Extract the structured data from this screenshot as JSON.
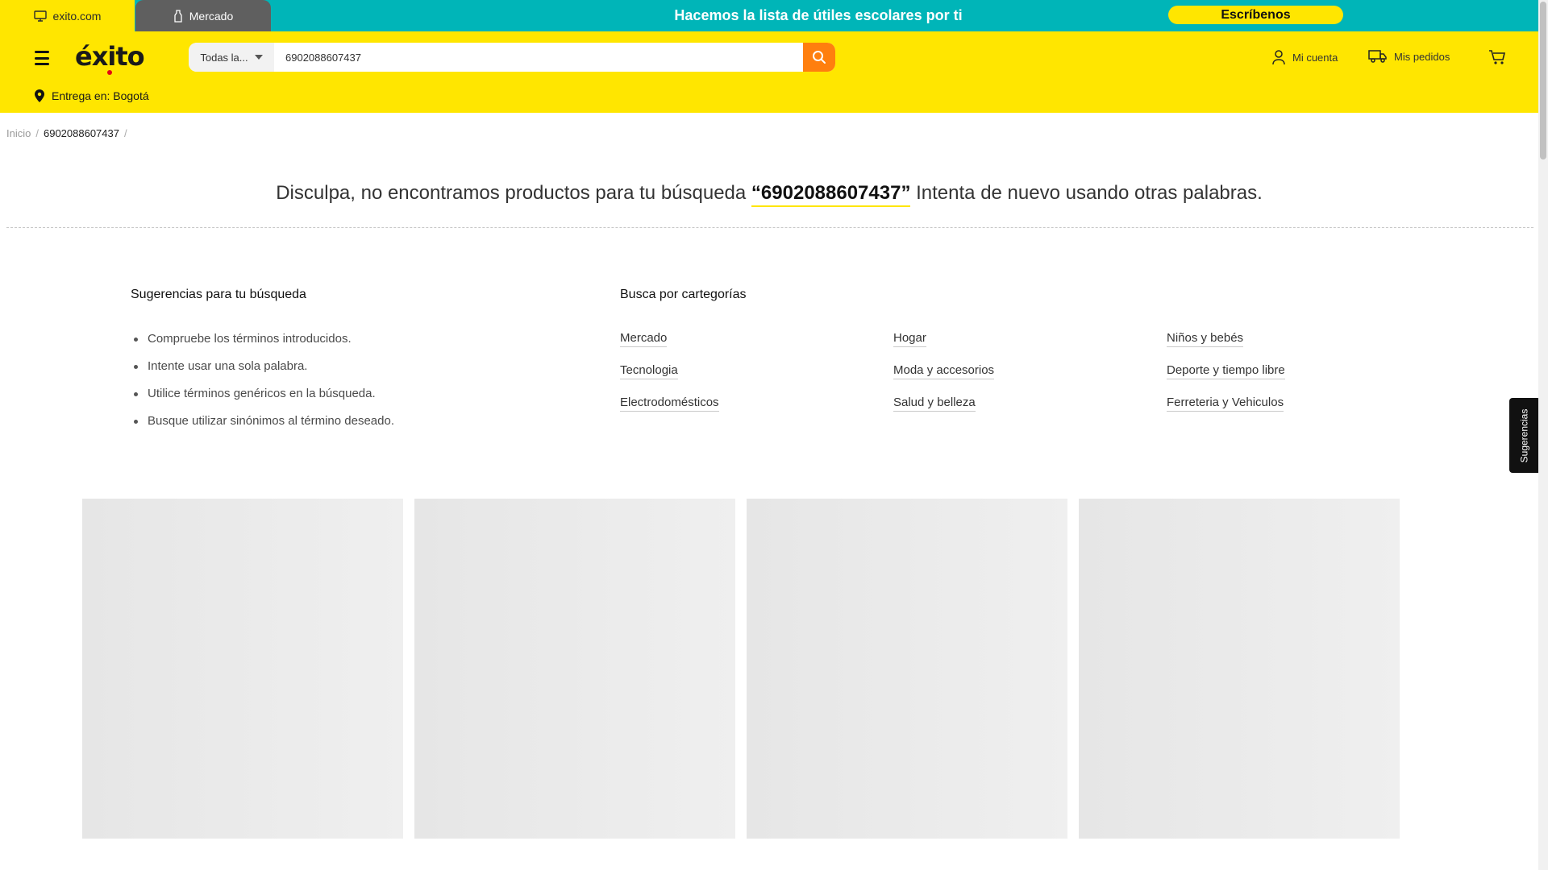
{
  "topbar": {
    "tab_exito": "exito.com",
    "tab_mercado": "Mercado",
    "promo_text": "Hacemos la lista de útiles escolares por ti",
    "promo_button": "Escríbenos"
  },
  "header": {
    "logo": "éxito",
    "search": {
      "category": "Todas la...",
      "value": "6902088607437"
    },
    "account_label": "Mi cuenta",
    "orders_label": "Mis pedidos",
    "delivery": "Entrega en: Bogotá"
  },
  "breadcrumb": {
    "home": "Inicio",
    "sep": "/",
    "current": "6902088607437"
  },
  "no_results": {
    "prefix": "Disculpa, no encontramos productos para tu búsqueda",
    "term": "“6902088607437”",
    "suffix": "Intenta de nuevo usando otras palabras."
  },
  "suggestions": {
    "title": "Sugerencias para tu búsqueda",
    "items": [
      "Compruebe los términos introducidos.",
      "Intente usar una sola palabra.",
      "Utilice términos genéricos en la búsqueda.",
      "Busque utilizar sinónimos al término deseado."
    ]
  },
  "categories": {
    "title": "Busca por cartegorías",
    "items": [
      "Mercado",
      "Tecnologia",
      "Electrodomésticos",
      "Hogar",
      "Moda y accesorios",
      "Salud y belleza",
      "Niños y bebés",
      "Deporte y tiempo libre",
      "Ferreteria y Vehiculos"
    ]
  },
  "side_tab": "Sugerencias",
  "colors": {
    "brand_yellow": "#ffe600",
    "teal": "#00b5b8",
    "search_orange": "#ff7f0e",
    "tab_gray": "#5f5f5f"
  }
}
